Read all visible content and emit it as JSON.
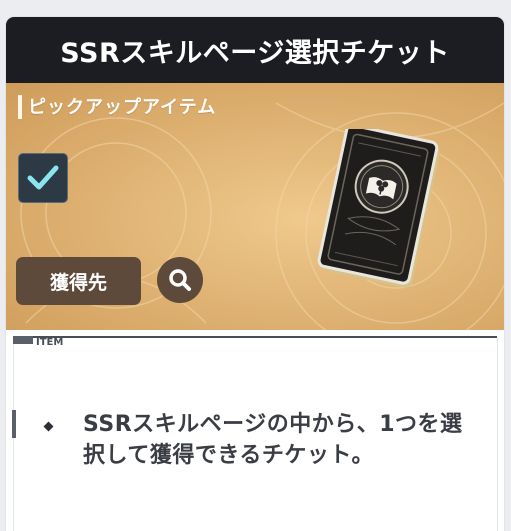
{
  "title": "SSRスキルページ選択チケット",
  "hero": {
    "pickup_label": "ピックアップアイテム",
    "checkbox_checked": true,
    "source_button_label": "獲得先",
    "search_icon": "magnifier-icon",
    "card_icon": "book-clover-icon"
  },
  "content": {
    "section_label": "ITEM",
    "description": "SSRスキルページの中から、1つを選択して獲得できるチケット。"
  },
  "colors": {
    "title_bar": "#1c1d22",
    "hero_gold": "#e0b475",
    "button_brown": "#5d4a3a",
    "checkbox_bg": "#2d3a45",
    "check_cyan": "#8ae6ee"
  }
}
